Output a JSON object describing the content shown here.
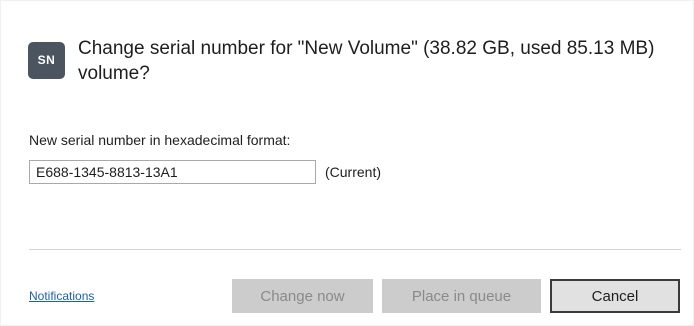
{
  "dialog": {
    "icon_text": "SN",
    "title": "Change serial number for \"New Volume\" (38.82 GB, used 85.13 MB) volume?",
    "field_label": "New serial number in hexadecimal format:",
    "serial_value": "E688-1345-8813-13A1",
    "current_note": "(Current)"
  },
  "footer": {
    "notifications_link": "Notifications",
    "change_now_label": "Change now",
    "place_in_queue_label": "Place in queue",
    "cancel_label": "Cancel"
  },
  "colors": {
    "icon_background": "#4a5560",
    "link": "#1a5fb4",
    "disabled_button": "#cccccc",
    "disabled_text": "#8a8a8a"
  }
}
